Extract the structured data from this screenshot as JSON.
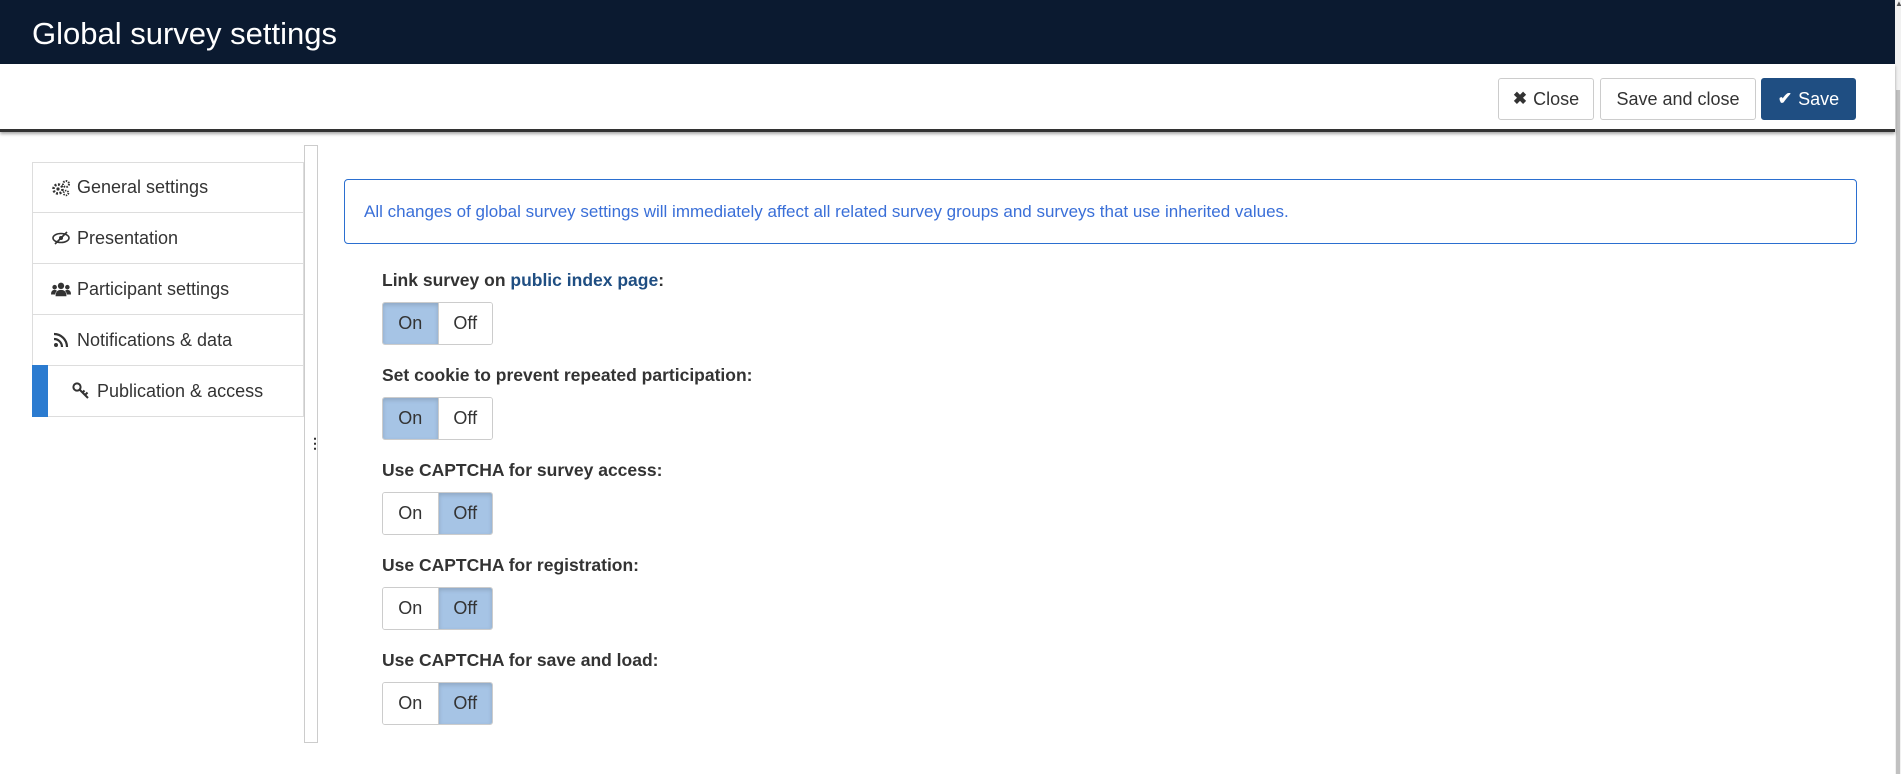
{
  "header": {
    "title": "Global survey settings"
  },
  "toolbar": {
    "close_label": "Close",
    "save_close_label": "Save and close",
    "save_label": "Save"
  },
  "sidebar": {
    "items": [
      {
        "label": "General settings",
        "icon": "gears-icon"
      },
      {
        "label": "Presentation",
        "icon": "eye-slash-icon"
      },
      {
        "label": "Participant settings",
        "icon": "users-icon"
      },
      {
        "label": "Notifications & data",
        "icon": "rss-icon"
      },
      {
        "label": "Publication & access",
        "icon": "key-icon",
        "active": true
      }
    ]
  },
  "notice": "All changes of global survey settings will immediately affect all related survey groups and surveys that use inherited values.",
  "settings": [
    {
      "label_prefix": "Link survey on ",
      "label_link": "public index page",
      "label_suffix": ":",
      "on": "On",
      "off": "Off",
      "value": "On"
    },
    {
      "label": "Set cookie to prevent repeated participation:",
      "on": "On",
      "off": "Off",
      "value": "On"
    },
    {
      "label": "Use CAPTCHA for survey access:",
      "on": "On",
      "off": "Off",
      "value": "Off"
    },
    {
      "label": "Use CAPTCHA for registration:",
      "on": "On",
      "off": "Off",
      "value": "Off"
    },
    {
      "label": "Use CAPTCHA for save and load:",
      "on": "On",
      "off": "Off",
      "value": "Off"
    }
  ],
  "colors": {
    "header_bg": "#0b1a30",
    "primary": "#1f4e82",
    "active_tab": "#2b7bd0",
    "toggle_selected": "#a6c4e5",
    "notice_text": "#3a6fd8"
  }
}
